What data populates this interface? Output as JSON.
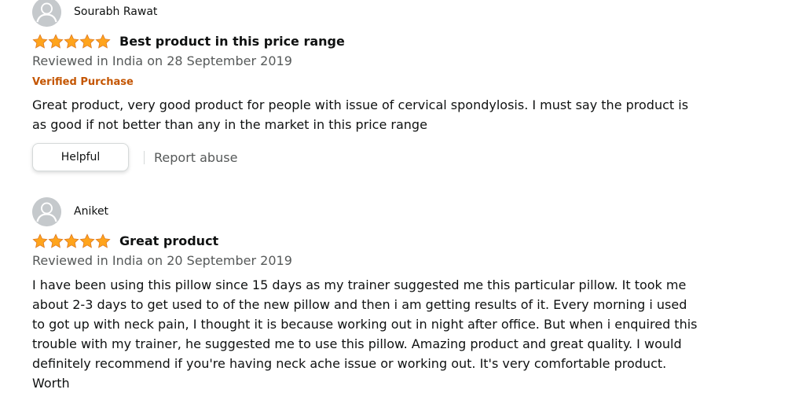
{
  "reviews": [
    {
      "reviewer": "Sourabh Rawat",
      "rating": 5,
      "title": "Best product in this price range",
      "date": "Reviewed in India on 28 September 2019",
      "verified": "Verified Purchase",
      "body": "Great product, very good product for people with issue of cervical spondylosis. I must say the product is as good if not better than any in the market in this price range",
      "helpful_label": "Helpful",
      "report_label": "Report abuse"
    },
    {
      "reviewer": "Aniket",
      "rating": 5,
      "title": "Great product",
      "date": "Reviewed in India on 20 September 2019",
      "body": "I have been using this pillow since 15 days as my trainer suggested me this particular pillow. It took me about 2-3 days to get used to of the new pillow and then i am getting results of it. Every morning i used to got up with neck pain, I thought it is because working out in night after office. But when i enquired this trouble with my trainer, he suggested me to use this pillow. Amazing product and great quality. I would definitely recommend if you're having neck ache issue or working out. It's very comfortable product. Worth"
    }
  ],
  "colors": {
    "star": "#FFA41C",
    "star_outline": "#DE7921",
    "verified": "#C45500",
    "muted_text": "#565959"
  }
}
